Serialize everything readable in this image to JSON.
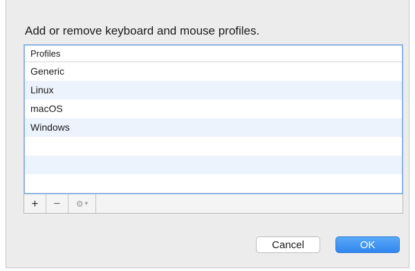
{
  "dialog": {
    "prompt": "Add or remove keyboard and mouse profiles."
  },
  "table": {
    "header": "Profiles",
    "rows": [
      "Generic",
      "Linux",
      "macOS",
      "Windows"
    ]
  },
  "toolbar": {
    "add_label": "+",
    "remove_label": "−",
    "gear_icon": "gear-icon",
    "gear_label": "⚙",
    "menu_caret": "▾"
  },
  "buttons": {
    "cancel_label": "Cancel",
    "ok_label": "OK"
  },
  "colors": {
    "accent": "#2f86ee",
    "row_alt": "#edf3fc",
    "focus_border": "#8db4e2"
  }
}
